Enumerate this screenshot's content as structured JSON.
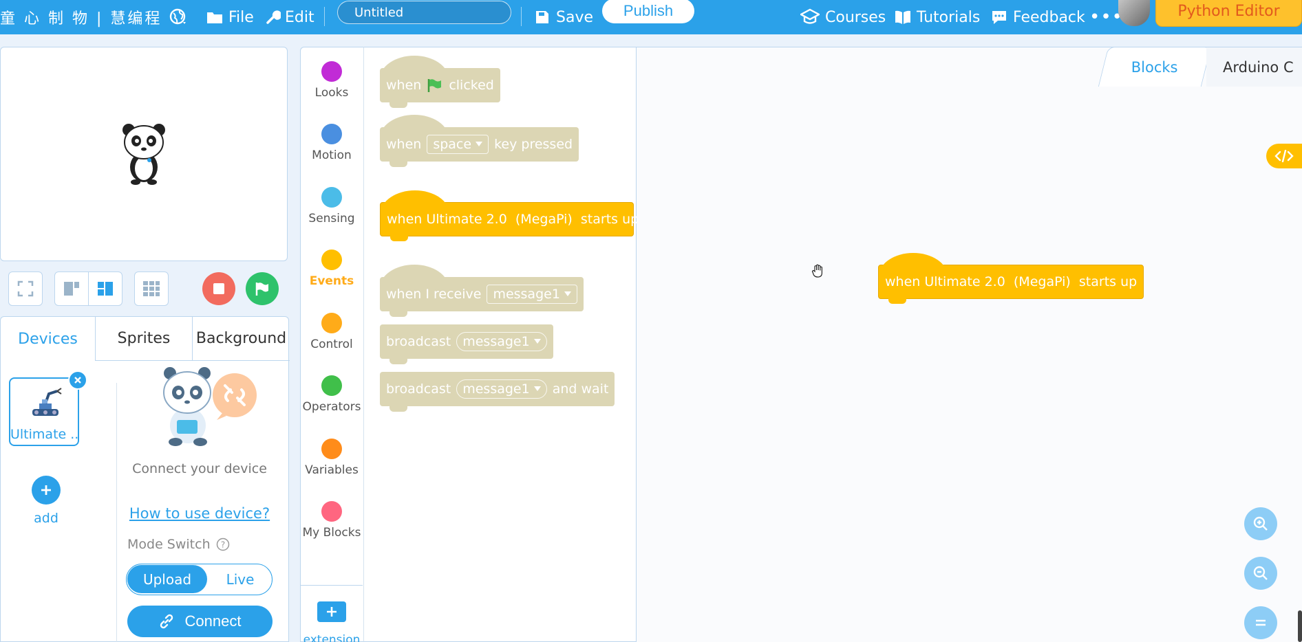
{
  "topbar": {
    "brand": "童 心 制 物 | 慧编程",
    "file_label": "File",
    "edit_label": "Edit",
    "project_name": "Untitled",
    "save_label": "Save",
    "publish_label": "Publish",
    "courses_label": "Courses",
    "tutorials_label": "Tutorials",
    "feedback_label": "Feedback",
    "more_label": "•••",
    "python_editor_label": "Python Editor"
  },
  "panel_tabs": {
    "devices": "Devices",
    "sprites": "Sprites",
    "background": "Background"
  },
  "devices": {
    "device_name": "Ultimate ...",
    "add_label": "add",
    "connect_text": "Connect your device",
    "howto_link": "How to use device?",
    "mode_switch_label": "Mode Switch",
    "mode_upload": "Upload",
    "mode_live": "Live",
    "connect_button": "Connect"
  },
  "categories": [
    {
      "label": "Looks",
      "color": "#c12bd6"
    },
    {
      "label": "Motion",
      "color": "#4a8fe0"
    },
    {
      "label": "Sensing",
      "color": "#4bbce8"
    },
    {
      "label": "Events",
      "color": "#ffbf00"
    },
    {
      "label": "Control",
      "color": "#ffab19"
    },
    {
      "label": "Operators",
      "color": "#40bf4a"
    },
    {
      "label": "Variables",
      "color": "#ff8c1a"
    },
    {
      "label": "My Blocks",
      "color": "#ff6680"
    }
  ],
  "extension_label": "extension",
  "palette": {
    "b1_when": "when",
    "b1_clicked": "clicked",
    "b2_when": "when",
    "b2_key": "space",
    "b2_pressed": "key pressed",
    "b3_text": "when Ultimate 2.0  (MegaPi)  starts up",
    "b4_text": "when I receive",
    "b4_msg": "message1",
    "b5_text": "broadcast",
    "b5_msg": "message1",
    "b6_text": "broadcast",
    "b6_msg": "message1",
    "b6_wait": "and wait"
  },
  "workspace": {
    "tab_blocks": "Blocks",
    "tab_arduino": "Arduino C",
    "block_text": "when Ultimate 2.0  (MegaPi)  starts up",
    "code_toggle": "</>"
  }
}
